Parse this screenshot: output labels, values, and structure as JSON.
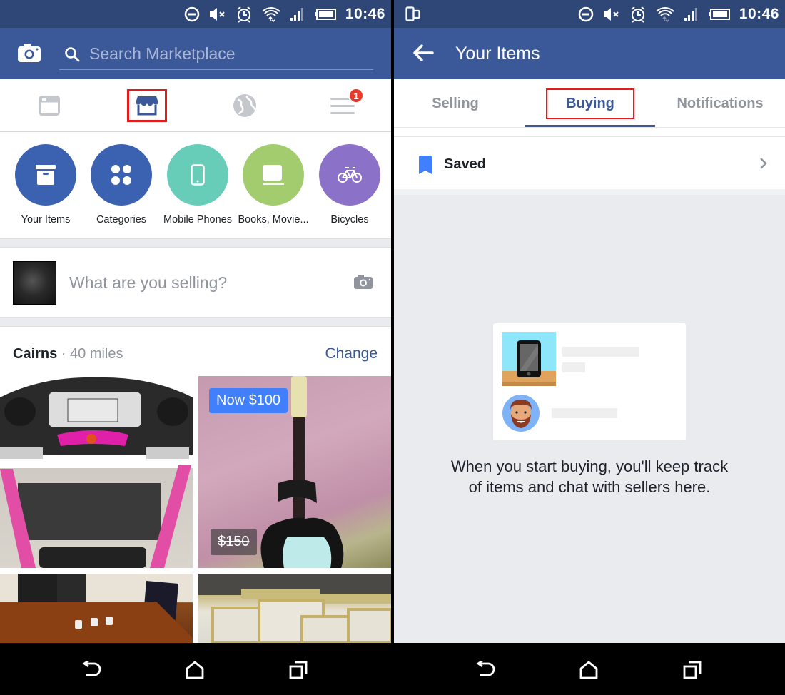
{
  "status_bar": {
    "time": "10:46",
    "icons": [
      "do-not-disturb-icon",
      "mute-icon",
      "alarm-icon",
      "wifi-icon",
      "signal-icon",
      "battery-icon"
    ]
  },
  "left_screen": {
    "search": {
      "placeholder": "Search Marketplace",
      "value": ""
    },
    "nav_tabs": [
      {
        "name": "news-feed",
        "icon": "newsfeed-icon",
        "active": false
      },
      {
        "name": "marketplace",
        "icon": "marketplace-store-icon",
        "active": true
      },
      {
        "name": "notifications",
        "icon": "globe-icon",
        "active": false
      },
      {
        "name": "menu",
        "icon": "menu-icon",
        "active": false,
        "badge": "1"
      }
    ],
    "categories": [
      {
        "label": "Your Items",
        "icon": "box-icon",
        "color": "#3b62b0"
      },
      {
        "label": "Categories",
        "icon": "grid-dots-icon",
        "color": "#3b62b0"
      },
      {
        "label": "Mobile Phones",
        "icon": "phone-icon",
        "color": "#67cdb8"
      },
      {
        "label": "Books, Movie...",
        "icon": "book-icon",
        "color": "#a2cc6e"
      },
      {
        "label": "Bicycles",
        "icon": "bicycle-icon",
        "color": "#8c71c8"
      }
    ],
    "composer": {
      "prompt": "What are you selling?"
    },
    "location": {
      "city": "Cairns",
      "distance": " · 40 miles",
      "change_label": "Change"
    },
    "listings": [
      {
        "name": "treadmill",
        "price_badge": "",
        "old_price": ""
      },
      {
        "name": "guitar",
        "price_badge": "Now $100",
        "old_price": "$150"
      },
      {
        "name": "dining-table",
        "price_badge": "",
        "old_price": ""
      },
      {
        "name": "picture-frames",
        "price_badge": "",
        "old_price": ""
      }
    ]
  },
  "right_screen": {
    "title": "Your Items",
    "tabs": [
      {
        "label": "Selling",
        "active": false
      },
      {
        "label": "Buying",
        "active": true
      },
      {
        "label": "Notifications",
        "active": false
      }
    ],
    "saved_label": "Saved",
    "empty_message": "When you start buying, you'll keep track of items and chat with sellers here."
  },
  "colors": {
    "brand": "#3b5998",
    "status_bar": "#2f4777",
    "highlight": "#e31b1b",
    "price_badge": "#4080ff",
    "link": "#365899",
    "notification_badge": "#e83a2c"
  }
}
